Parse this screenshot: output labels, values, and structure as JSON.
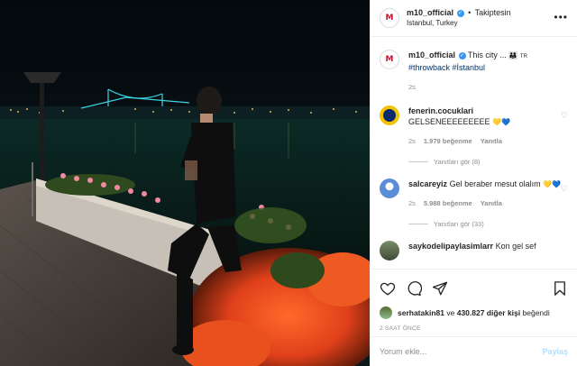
{
  "post": {
    "username": "m10_official",
    "verified_icon": "verified-badge-icon",
    "dot": "•",
    "follow_status": "Takiptesin",
    "location": "Istanbul, Turkey",
    "more_icon": "more-options-icon"
  },
  "caption": {
    "username": "m10_official",
    "text": "This city ...",
    "flag": "TR",
    "hashtags": "#throwback #İstanbul",
    "time": "2s"
  },
  "comments": [
    {
      "username": "fenerin.cocuklari",
      "text": "GELSENEEEEEEEEE",
      "emojis": "💛💙",
      "time": "2s",
      "likes": "1.979 beğenme",
      "reply": "Yanıtla",
      "view_replies": "Yanıtları gör (8)"
    },
    {
      "username": "salcareyiz",
      "text": "Gel beraber mesut olalım",
      "emojis": "💛💙",
      "time": "2s",
      "likes": "5.988 beğenme",
      "reply": "Yanıtla",
      "view_replies": "Yanıtları gör (33)"
    },
    {
      "username": "saykodelipaylasimlarr",
      "text": "Kon gel sef"
    }
  ],
  "actions": {
    "liked_by_user": "serhatakin81",
    "liked_by_and": "ve",
    "liked_by_count": "430.827 diğer kişi",
    "liked_by_suffix": "beğendi",
    "time_ago": "2 SAAT ÖNCE"
  },
  "add_comment": {
    "placeholder": "Yorum ekle...",
    "post_label": "Paylaş"
  },
  "colors": {
    "accent": "#3897f0",
    "post_disabled": "#b2dffc",
    "muted": "#8e8e8e"
  }
}
